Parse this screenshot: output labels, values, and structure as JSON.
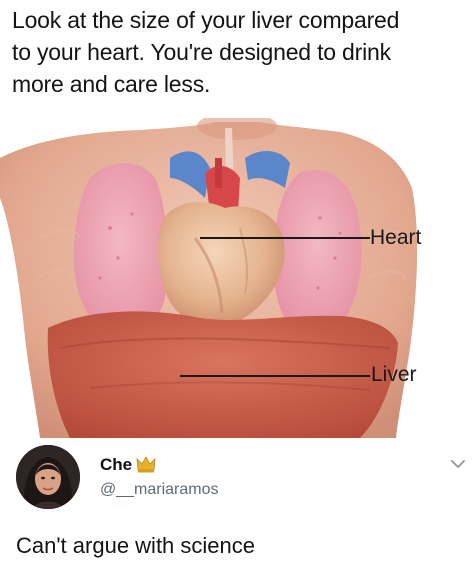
{
  "caption": {
    "line1": "Look at the size of your liver compared",
    "line2": "to your heart. You're designed to drink",
    "line3": "more and care less."
  },
  "illustration": {
    "labels": {
      "heart": "Heart",
      "liver": "Liver"
    }
  },
  "tweet": {
    "author": {
      "display_name": "Che",
      "badge_icon": "crown-icon",
      "handle": "@__mariaramos"
    },
    "menu_icon": "chevron-down-icon",
    "text": "Can't argue with science"
  }
}
